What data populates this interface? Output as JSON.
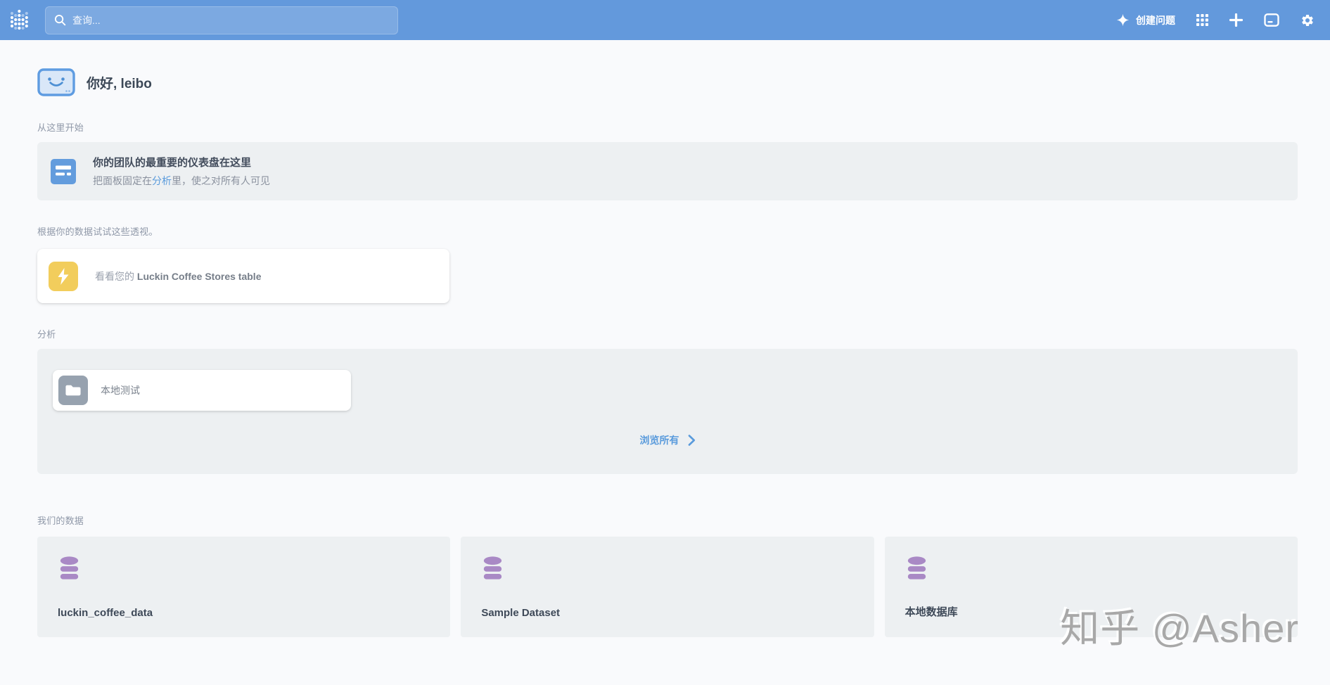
{
  "navbar": {
    "search_placeholder": "查询...",
    "create_question_label": "创建问题"
  },
  "greeting": {
    "title": "你好, leibo"
  },
  "start_here": {
    "label": "从这里开始",
    "banner_title": "你的团队的最重要的仪表盘在这里",
    "banner_sub_prefix": "把面板固定在",
    "banner_sub_link": "分析",
    "banner_sub_suffix": "里，使之对所有人可见"
  },
  "xray": {
    "label": "根据你的数据试试这些透视。",
    "card_prefix": "看看您的 ",
    "card_table": "Luckin Coffee Stores table"
  },
  "collections": {
    "label": "分析",
    "folder_name": "本地测试",
    "browse_all_label": "浏览所有"
  },
  "databases": {
    "label": "我们的数据",
    "items": [
      {
        "name": "luckin_coffee_data"
      },
      {
        "name": "Sample Dataset"
      },
      {
        "name": "本地数据库"
      }
    ]
  },
  "watermark": "知乎 @Asher",
  "colors": {
    "navbar_blue": "#6399DC",
    "link_blue": "#5A9BDC",
    "gold": "#F2CD5C",
    "database_purple": "#A989C5",
    "folder_gray": "#97A2AF",
    "section_bg": "#EDF0F2",
    "page_bg": "#F9FAFC"
  }
}
